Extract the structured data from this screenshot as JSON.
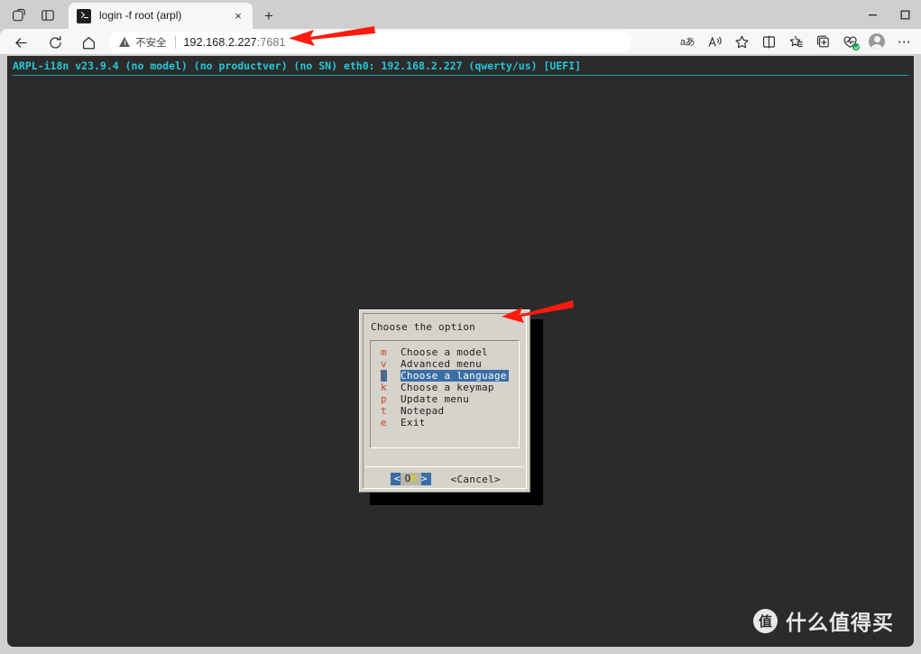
{
  "browser": {
    "titlebar": {
      "copilot_icon": "copilot-icon",
      "tab_search_icon": "tab-search-icon",
      "new_tab_label": "+",
      "tabs": [
        {
          "title": "login -f root (arpl)",
          "favicon": "terminal-icon",
          "close_label": "×",
          "active": true
        }
      ],
      "window_controls": [
        {
          "name": "minimize",
          "glyph": "—"
        },
        {
          "name": "maximize",
          "glyph": "☐"
        }
      ]
    },
    "toolbar": {
      "back_icon": "back-arrow-icon",
      "reload_icon": "reload-icon",
      "home_icon": "home-icon",
      "omnibox": {
        "security_label": "不安全",
        "security_icon": "warning-triangle-icon",
        "url_host": "192.168.2.227",
        "url_port": ":7681"
      },
      "right_icons": [
        {
          "name": "translate-icon",
          "glyph": "aあ"
        },
        {
          "name": "read-aloud-icon",
          "glyph": "A"
        },
        {
          "name": "favorite-star-icon",
          "glyph": "☆"
        },
        {
          "name": "split-screen-icon",
          "glyph": ""
        },
        {
          "name": "favorites-list-icon",
          "glyph": ""
        },
        {
          "name": "collections-icon",
          "glyph": ""
        },
        {
          "name": "browser-essentials-icon",
          "glyph": ""
        },
        {
          "name": "profile-avatar",
          "glyph": ""
        },
        {
          "name": "settings-more-icon",
          "glyph": "⋯"
        }
      ]
    }
  },
  "terminal": {
    "background": "#2b2b2b",
    "header_color": "#24c8d8",
    "header_line": "ARPL-i18n v23.9.4 (no model) (no productver) (no SN) eth0: 192.168.2.227 (qwerty/us) [UEFI]"
  },
  "dialog": {
    "title": "Choose the option",
    "accent_selected_bg": "#3b6ea5",
    "key_color": "#c7402b",
    "background": "#d6d3cb",
    "items": [
      {
        "key": "m",
        "label": "Choose a model",
        "selected": false
      },
      {
        "key": "v",
        "label": "Advanced menu",
        "selected": false
      },
      {
        "key": "l",
        "label": "Choose a language",
        "selected": true
      },
      {
        "key": "k",
        "label": "Choose a keymap",
        "selected": false
      },
      {
        "key": "p",
        "label": "Update menu",
        "selected": false
      },
      {
        "key": "t",
        "label": "Notepad",
        "selected": false
      },
      {
        "key": "e",
        "label": "Exit",
        "selected": false
      }
    ],
    "buttons": {
      "ok_left_bracket": "<",
      "ok_o": "O",
      "ok_k": "K",
      "ok_right_bracket": ">",
      "cancel_label": "<Cancel>"
    }
  },
  "annotations": {
    "arrow_color": "#ff1a0f",
    "arrows": [
      {
        "name": "arrow-to-url-bar",
        "points_to": "omnibox-url"
      },
      {
        "name": "arrow-to-choose-language",
        "points_to": "menu-item-choose-a-language"
      }
    ]
  },
  "watermark": {
    "logo_char": "值",
    "text": "什么值得买"
  }
}
